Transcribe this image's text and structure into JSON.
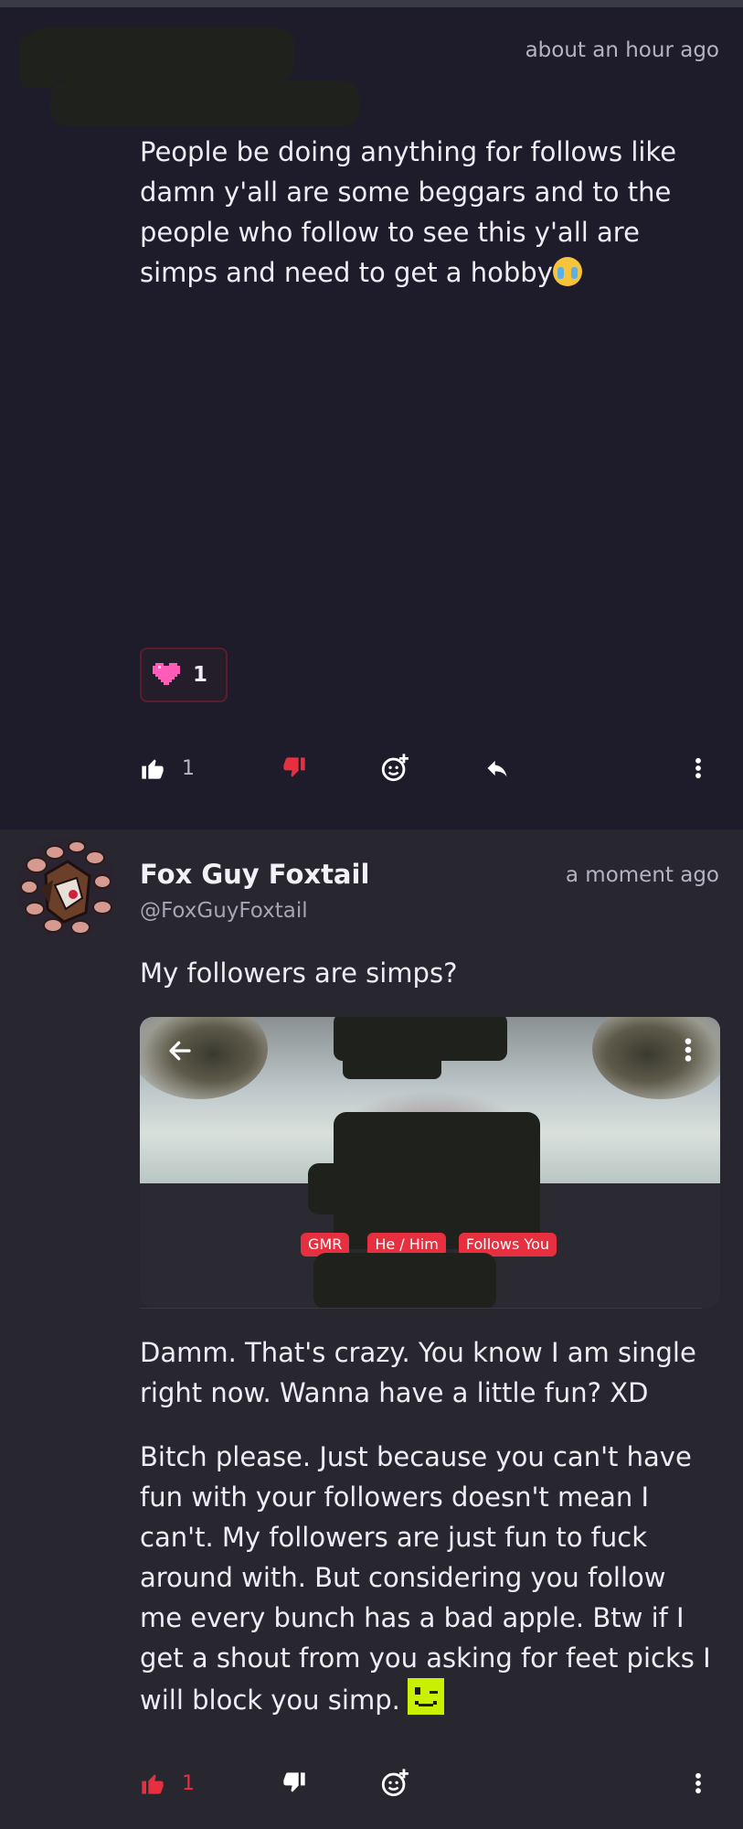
{
  "post1": {
    "timestamp": "about an hour ago",
    "author_paren": "(",
    "text": "People be doing anything for follows like damn y'all are some beggars and to the people who follow to see this y'all are simps and need to get a hobby",
    "reaction": {
      "icon": "pink-heart-icon",
      "count": "1"
    },
    "actions": {
      "likes": "1"
    }
  },
  "post2": {
    "author_name": "Fox Guy Foxtail",
    "author_handle": "@FoxGuyFoxtail",
    "timestamp": "a moment ago",
    "quote_text": "My followers are simps?",
    "embed": {
      "badges": [
        "GMR",
        "He / Him",
        "Follows You"
      ]
    },
    "reply1": "Damm. That's crazy. You know I am single right now. Wanna have a little fun? XD",
    "reply2": "Bitch please. Just because you can't have fun with your followers doesn't mean I can't. My followers are just fun to fuck around with. But considering you follow me every bunch has a bad apple. Btw if I get a shout from you asking for feet picks I will block you simp.",
    "actions": {
      "likes": "1"
    }
  },
  "colors": {
    "background_dark": "#1e1b2b",
    "background_post2": "#28262f",
    "accent_red": "#e6303f",
    "heart_pink": "#ff5cb8",
    "text": "#efedf4",
    "muted": "#a8a4b5"
  }
}
